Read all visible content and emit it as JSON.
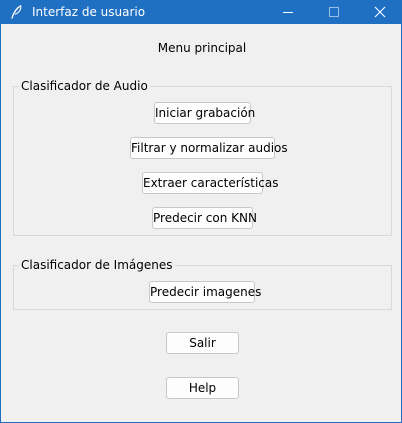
{
  "window": {
    "title": "Interfaz de usuario",
    "icon": "feather-icon",
    "titlebar_color": "#1f6fc3",
    "controls": [
      "minimize-icon",
      "maximize-icon",
      "close-icon"
    ]
  },
  "main": {
    "title": "Menu principal"
  },
  "audio_group": {
    "label": "Clasificador de Audio",
    "buttons": [
      "Iniciar grabación",
      "Filtrar y normalizar audios",
      "Extraer características",
      "Predecir con KNN"
    ]
  },
  "image_group": {
    "label": "Clasificador de Imágenes",
    "buttons": [
      "Predecir imagenes"
    ]
  },
  "footer": {
    "exit_label": "Salir",
    "help_label": "Help"
  }
}
